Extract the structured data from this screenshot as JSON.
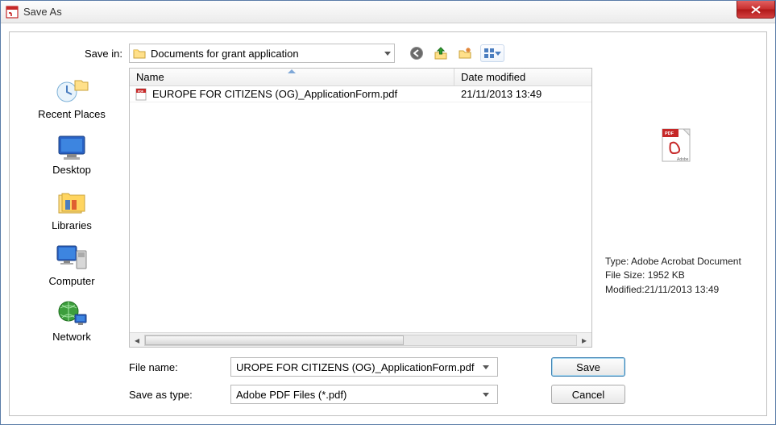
{
  "window": {
    "title": "Save As"
  },
  "savein": {
    "label": "Save in:",
    "folder": "Documents for grant application"
  },
  "places": [
    {
      "key": "recent",
      "label": "Recent Places"
    },
    {
      "key": "desktop",
      "label": "Desktop"
    },
    {
      "key": "libraries",
      "label": "Libraries"
    },
    {
      "key": "computer",
      "label": "Computer"
    },
    {
      "key": "network",
      "label": "Network"
    }
  ],
  "filelist": {
    "columns": {
      "name": "Name",
      "date": "Date modified"
    },
    "rows": [
      {
        "name": "EUROPE FOR CITIZENS (OG)_ApplicationForm.pdf",
        "date": "21/11/2013 13:49"
      }
    ]
  },
  "preview": {
    "type_label": "Type:",
    "type_value": "Adobe Acrobat Document",
    "size_label": "File Size:",
    "size_value": "1952 KB",
    "mod_label": "Modified:",
    "mod_value": "21/11/2013 13:49"
  },
  "filename": {
    "label": "File name:",
    "value": "UROPE FOR CITIZENS (OG)_ApplicationForm.pdf"
  },
  "saveastype": {
    "label": "Save as type:",
    "value": "Adobe PDF Files (*.pdf)"
  },
  "buttons": {
    "save": "Save",
    "cancel": "Cancel"
  },
  "icons": {
    "back": "back-icon",
    "up": "up-one-level-icon",
    "newfolder": "new-folder-icon",
    "viewmenu": "view-menu-icon"
  }
}
